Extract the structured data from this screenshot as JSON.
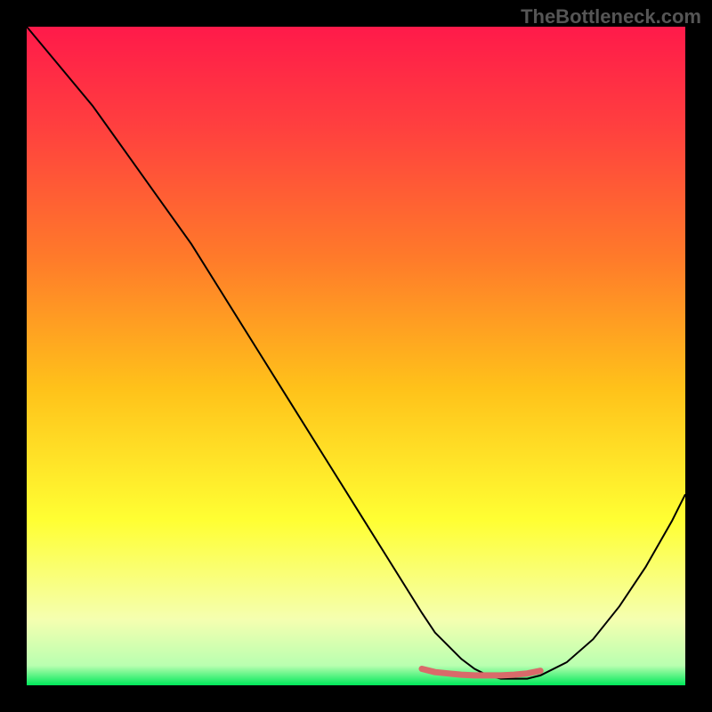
{
  "watermark": "TheBottleneck.com",
  "chart_data": {
    "type": "line",
    "title": "",
    "xlabel": "",
    "ylabel": "",
    "xlim": [
      0,
      100
    ],
    "ylim": [
      0,
      100
    ],
    "grid": false,
    "legend": false,
    "annotations": [],
    "background_gradient": {
      "stops": [
        {
          "offset": 0.0,
          "color": "#ff1a4a"
        },
        {
          "offset": 0.15,
          "color": "#ff3f3f"
        },
        {
          "offset": 0.35,
          "color": "#ff7a2a"
        },
        {
          "offset": 0.55,
          "color": "#ffc21a"
        },
        {
          "offset": 0.75,
          "color": "#ffff33"
        },
        {
          "offset": 0.9,
          "color": "#f5ffb0"
        },
        {
          "offset": 0.97,
          "color": "#b9ffb0"
        },
        {
          "offset": 1.0,
          "color": "#00e85a"
        }
      ]
    },
    "series": [
      {
        "name": "bottleneck-curve",
        "color": "#000000",
        "width": 2,
        "x": [
          0,
          5,
          10,
          15,
          20,
          25,
          30,
          35,
          40,
          45,
          50,
          55,
          60,
          62,
          64,
          66,
          68,
          70,
          72,
          74,
          76,
          78,
          82,
          86,
          90,
          94,
          98,
          100
        ],
        "y": [
          100,
          94,
          88,
          81,
          74,
          67,
          59,
          51,
          43,
          35,
          27,
          19,
          11,
          8,
          6,
          4,
          2.5,
          1.5,
          1.0,
          1.0,
          1.0,
          1.5,
          3.5,
          7,
          12,
          18,
          25,
          29
        ]
      },
      {
        "name": "optimal-marker",
        "color": "#d96a6a",
        "width": 7,
        "linecap": "round",
        "x": [
          60,
          62,
          64,
          66,
          68,
          70,
          72,
          74,
          76,
          78
        ],
        "y": [
          2.5,
          2.0,
          1.8,
          1.6,
          1.5,
          1.5,
          1.5,
          1.6,
          1.8,
          2.2
        ]
      }
    ]
  }
}
